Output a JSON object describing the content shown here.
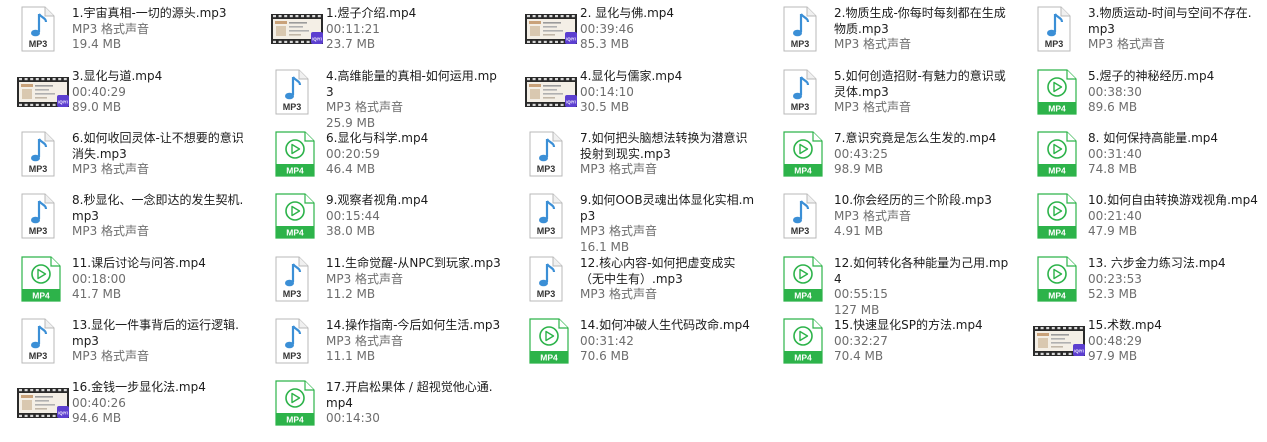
{
  "files": [
    {
      "icon": "mp3",
      "name": "1.宇宙真相-一切的源头.mp3",
      "meta": [
        "MP3 格式声音",
        "19.4 MB"
      ]
    },
    {
      "icon": "thumb",
      "name": "1.煜子介绍.mp4",
      "meta": [
        "00:11:21",
        "23.7 MB"
      ]
    },
    {
      "icon": "thumb",
      "name": "2. 显化与佛.mp4",
      "meta": [
        "00:39:46",
        "85.3 MB"
      ]
    },
    {
      "icon": "mp3",
      "name": "2.物质生成-你每时每刻都在生成物质.mp3",
      "meta": [
        "MP3 格式声音"
      ]
    },
    {
      "icon": "mp3",
      "name": "3.物质运动-时间与空间不存在.mp3",
      "meta": [
        "MP3 格式声音"
      ]
    },
    {
      "icon": "thumb",
      "name": "3.显化与道.mp4",
      "meta": [
        "00:40:29",
        "89.0 MB"
      ]
    },
    {
      "icon": "mp3",
      "name": "4.高维能量的真相-如何运用.mp3",
      "meta": [
        "MP3 格式声音",
        "25.9 MB"
      ]
    },
    {
      "icon": "thumb",
      "name": "4.显化与儒家.mp4",
      "meta": [
        "00:14:10",
        "30.5 MB"
      ]
    },
    {
      "icon": "mp3",
      "name": "5.如何创造招财-有魅力的意识或灵体.mp3",
      "meta": [
        "MP3 格式声音"
      ]
    },
    {
      "icon": "mp4",
      "name": "5.煜子的神秘经历.mp4",
      "meta": [
        "00:38:30",
        "89.6 MB"
      ]
    },
    {
      "icon": "mp3",
      "name": "6.如何收回灵体-让不想要的意识消失.mp3",
      "meta": [
        "MP3 格式声音"
      ]
    },
    {
      "icon": "mp4",
      "name": "6.显化与科学.mp4",
      "meta": [
        "00:20:59",
        "46.4 MB"
      ]
    },
    {
      "icon": "mp3",
      "name": "7.如何把头脑想法转换为潜意识投射到现实.mp3",
      "meta": [
        "MP3 格式声音"
      ]
    },
    {
      "icon": "mp4",
      "name": "7.意识究竟是怎么生发的.mp4",
      "meta": [
        "00:43:25",
        "98.9 MB"
      ]
    },
    {
      "icon": "mp4",
      "name": "8. 如何保持高能量.mp4",
      "meta": [
        "00:31:40",
        "74.8 MB"
      ]
    },
    {
      "icon": "mp3",
      "name": "8.秒显化、一念即达的发生契机.mp3",
      "meta": [
        "MP3 格式声音"
      ]
    },
    {
      "icon": "mp4",
      "name": "9.观察者视角.mp4",
      "meta": [
        "00:15:44",
        "38.0 MB"
      ]
    },
    {
      "icon": "mp3",
      "name": "9.如何OOB灵魂出体显化实相.mp3",
      "meta": [
        "MP3 格式声音",
        "16.1 MB"
      ]
    },
    {
      "icon": "mp3",
      "name": "10.你会经历的三个阶段.mp3",
      "meta": [
        "MP3 格式声音",
        "4.91 MB"
      ]
    },
    {
      "icon": "mp4",
      "name": "10.如何自由转换游戏视角.mp4",
      "meta": [
        "00:21:40",
        "47.9 MB"
      ]
    },
    {
      "icon": "mp4",
      "name": "11.课后讨论与问答.mp4",
      "meta": [
        "00:18:00",
        "41.7 MB"
      ]
    },
    {
      "icon": "mp3",
      "name": "11.生命觉醒-从NPC到玩家.mp3",
      "meta": [
        "MP3 格式声音",
        "11.2 MB"
      ]
    },
    {
      "icon": "mp3",
      "name": "12.核心内容-如何把虚变成实（无中生有）.mp3",
      "meta": [
        "MP3 格式声音"
      ]
    },
    {
      "icon": "mp4",
      "name": "12.如何转化各种能量为己用.mp4",
      "meta": [
        "00:55:15",
        "127 MB"
      ]
    },
    {
      "icon": "mp4",
      "name": "13. 六步金力练习法.mp4",
      "meta": [
        "00:23:53",
        "52.3 MB"
      ]
    },
    {
      "icon": "mp3",
      "name": "13.显化一件事背后的运行逻辑.mp3",
      "meta": [
        "MP3 格式声音"
      ]
    },
    {
      "icon": "mp3",
      "name": "14.操作指南-今后如何生活.mp3",
      "meta": [
        "MP3 格式声音",
        "11.1 MB"
      ]
    },
    {
      "icon": "mp4",
      "name": "14.如何冲破人生代码改命.mp4",
      "meta": [
        "00:31:42",
        "70.6 MB"
      ]
    },
    {
      "icon": "mp4",
      "name": "15.快速显化SP的方法.mp4",
      "meta": [
        "00:32:27",
        "70.4 MB"
      ]
    },
    {
      "icon": "thumb",
      "name": "15.术数.mp4",
      "meta": [
        "00:48:29",
        "97.9 MB"
      ]
    },
    {
      "icon": "thumb",
      "name": "16.金钱一步显化法.mp4",
      "meta": [
        "00:40:26",
        "94.6 MB"
      ]
    },
    {
      "icon": "mp4",
      "name": "17.开启松果体 / 超视觉他心通.mp4",
      "meta": [
        "00:14:30"
      ]
    }
  ],
  "icon_labels": {
    "mp3": "MP3",
    "mp4": "MP4",
    "badge": "iQIYI"
  },
  "colors": {
    "mp3_note": "#3b8fd6",
    "mp4_green": "#2db34a",
    "thumb_badge": "#5c3fd0"
  }
}
